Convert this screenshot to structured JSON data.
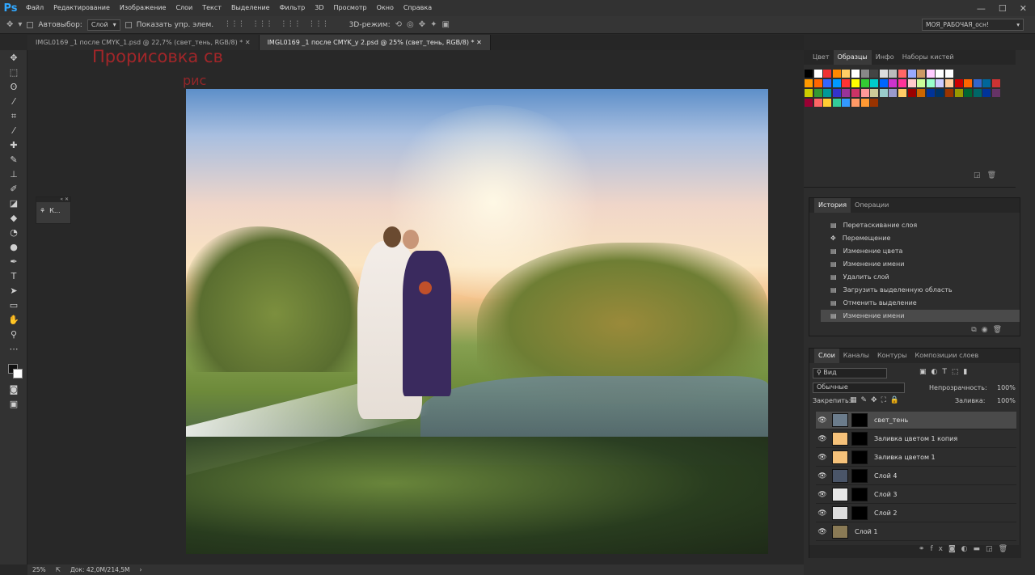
{
  "app": {
    "logo": "Ps"
  },
  "menu": [
    "Файл",
    "Редактирование",
    "Изображение",
    "Слои",
    "Текст",
    "Выделение",
    "Фильтр",
    "3D",
    "Просмотр",
    "Окно",
    "Справка"
  ],
  "options": {
    "autoselect_label": "Автовыбор:",
    "autoselect_value": "Слой",
    "show_transform_label": "Показать упр. элем.",
    "mode3d_label": "3D-режим:",
    "workspace": "МОЯ_РАБОЧАЯ_осн!"
  },
  "tabs": [
    {
      "label": "IMGL0169 _1 после CMYK_1.psd @ 22,7% (свет_тень, RGB/8) *"
    },
    {
      "label": "IMGL0169 _1 после CMYK_у 2.psd @ 25% (свет_тень, RGB/8) *"
    }
  ],
  "watermark": {
    "line1": "Прорисовка св",
    "line2": "рис"
  },
  "float_panel": {
    "label": "К..."
  },
  "status": {
    "zoom": "25%",
    "doc": "Док: 42,0M/214,5M"
  },
  "swatch_panel": {
    "tabs": [
      "Цвет",
      "Образцы",
      "Инфо",
      "Наборы кистей"
    ],
    "active": "Образцы"
  },
  "history_panel": {
    "tabs": [
      "История",
      "Операции"
    ],
    "active": "История",
    "items": [
      "Перетаскивание слоя",
      "Перемещение",
      "Изменение цвета",
      "Изменение имени",
      "Удалить слой",
      "Загрузить выделенную область",
      "Отменить выделение",
      "Изменение имени"
    ]
  },
  "layers_panel": {
    "tabs": [
      "Слои",
      "Каналы",
      "Контуры",
      "Композиции слоев"
    ],
    "active": "Слои",
    "filter": "Вид",
    "blend": "Обычные",
    "opacity_label": "Непрозрачность:",
    "opacity": "100%",
    "lock_label": "Закрепить:",
    "fill_label": "Заливка:",
    "fill": "100%",
    "layers": [
      {
        "name": "свет_тень",
        "thumb": "#6b7c8c",
        "mask": true
      },
      {
        "name": "Заливка цветом 1 копия",
        "thumb": "#f6c27a",
        "mask": true
      },
      {
        "name": "Заливка цветом 1",
        "thumb": "#f6c27a",
        "mask": true
      },
      {
        "name": "Слой 4",
        "thumb": "#4a5568",
        "mask": true
      },
      {
        "name": "Слой 3",
        "thumb": "#e8e8e8",
        "mask": true
      },
      {
        "name": "Слой 2",
        "thumb": "#dddddd",
        "mask": true
      },
      {
        "name": "Слой 1",
        "thumb": "#8a7a55",
        "mask": false
      }
    ]
  }
}
